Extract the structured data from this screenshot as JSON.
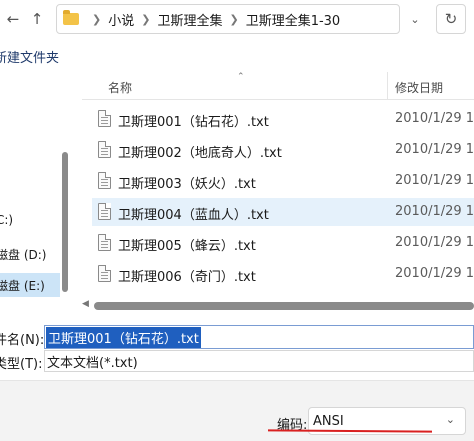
{
  "address_bar": {
    "back_icon": "back-arrow-icon",
    "up_icon": "up-arrow-icon",
    "crumbs": [
      "小说",
      "卫斯理全集",
      "卫斯理全集1-30"
    ]
  },
  "toolbar": {
    "new_folder_label": "新建文件夹"
  },
  "nav": {
    "items": [
      {
        "label": "C:)",
        "selected": false
      },
      {
        "label": "磁盘 (D:)",
        "selected": false
      },
      {
        "label": "磁盘 (E:)",
        "selected": true
      }
    ]
  },
  "file_list": {
    "col_name": "名称",
    "col_date": "修改日期",
    "rows": [
      {
        "name": "卫斯理001（钻石花）.txt",
        "date": "2010/1/29 18",
        "selected": false
      },
      {
        "name": "卫斯理002（地底奇人）.txt",
        "date": "2010/1/29 18",
        "selected": false
      },
      {
        "name": "卫斯理003（妖火）.txt",
        "date": "2010/1/29 18",
        "selected": false
      },
      {
        "name": "卫斯理004（蓝血人）.txt",
        "date": "2010/1/29 18",
        "selected": true
      },
      {
        "name": "卫斯理005（蜂云）.txt",
        "date": "2010/1/29 18",
        "selected": false
      },
      {
        "name": "卫斯理006（奇门）.txt",
        "date": "2010/1/29 18",
        "selected": false
      }
    ]
  },
  "form": {
    "filename_label": "件名(N):",
    "filename_value": "卫斯理001（钻石花）.txt",
    "filetype_label": "类型(T):",
    "filetype_value": "文本文档(*.txt)",
    "encoding_label": "编码:",
    "encoding_value": "ANSI"
  },
  "colors": {
    "accent": "#1f5fbf",
    "selection": "#cce4f7",
    "annotation": "#d92020"
  }
}
